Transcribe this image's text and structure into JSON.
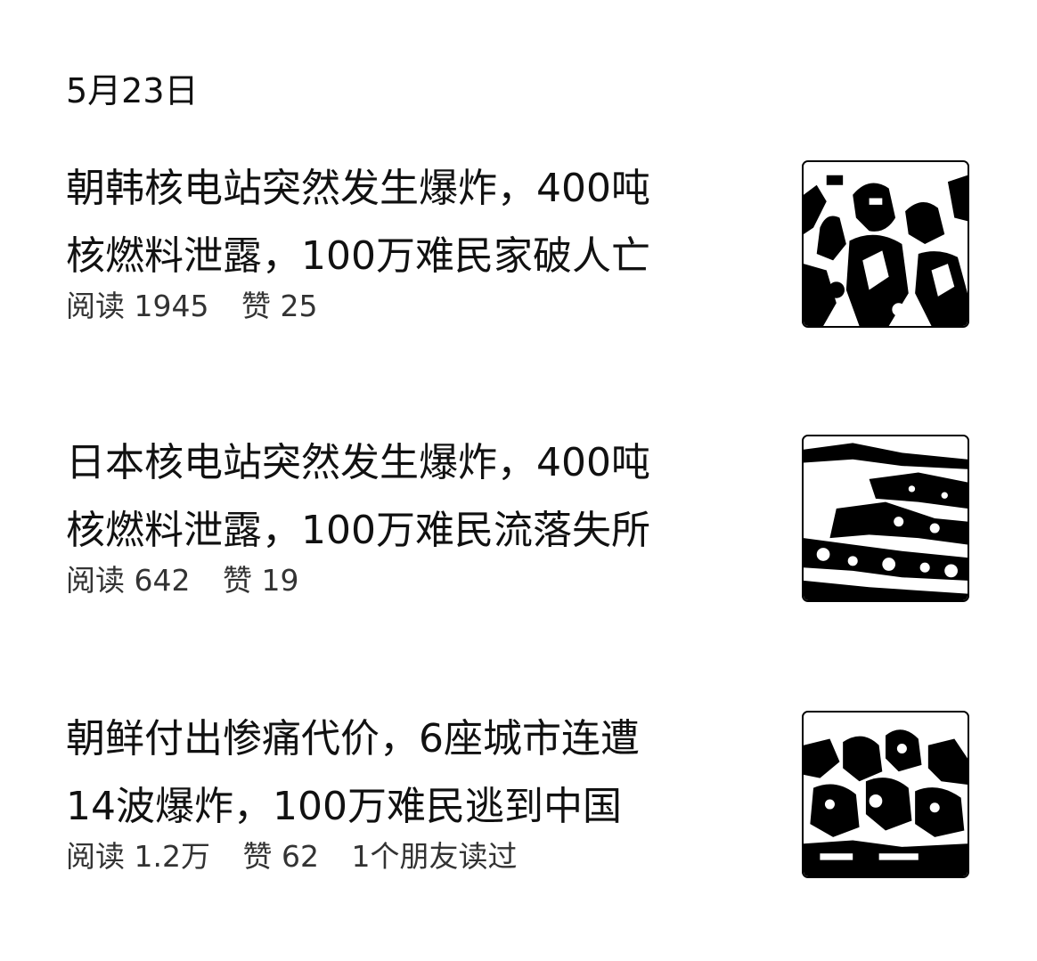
{
  "date_header": "5月23日",
  "articles": [
    {
      "title_line1": "朝韩核电站突然发生爆炸，400吨",
      "title_line2": "核燃料泄露，100万难民家破人亡",
      "reads": "阅读 1945",
      "likes": "赞 25",
      "friends": ""
    },
    {
      "title_line1": "日本核电站突然发生爆炸，400吨",
      "title_line2": "核燃料泄露，100万难民流落失所",
      "reads": "阅读 642",
      "likes": "赞 19",
      "friends": ""
    },
    {
      "title_line1": "朝鲜付出惨痛代价，6座城市连遭",
      "title_line2": "14波爆炸，100万难民逃到中国",
      "reads": "阅读 1.2万",
      "likes": "赞 62",
      "friends": "1个朋友读过"
    }
  ]
}
